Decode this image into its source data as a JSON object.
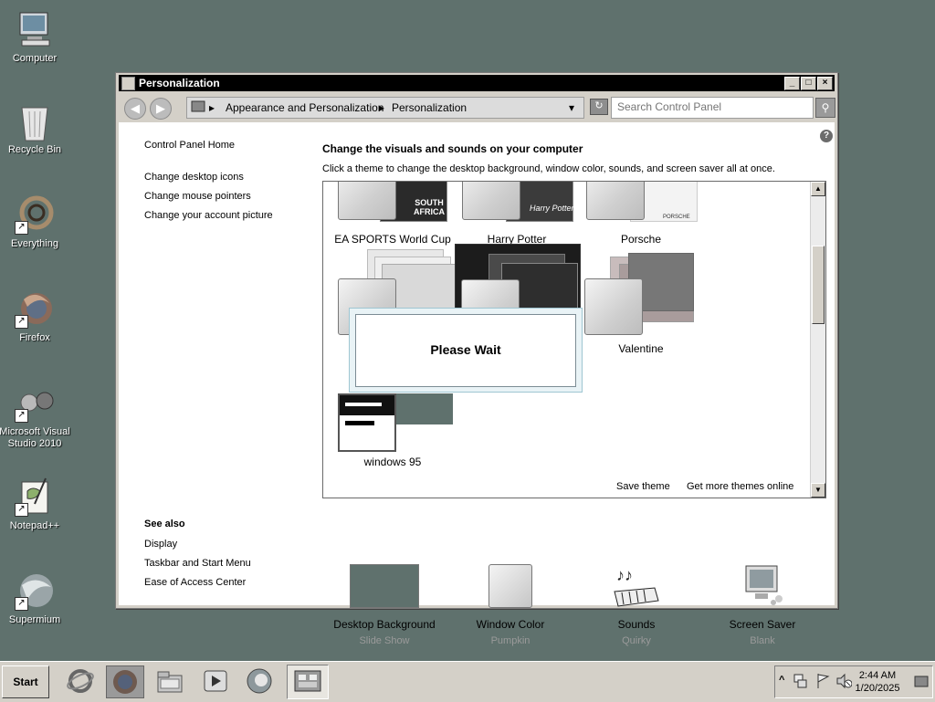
{
  "desktop": {
    "icons": [
      {
        "label": "Computer"
      },
      {
        "label": "Recycle Bin"
      },
      {
        "label": "Everything"
      },
      {
        "label": "Firefox"
      },
      {
        "label": "Microsoft Visual Studio 2010"
      },
      {
        "label": "Notepad++"
      },
      {
        "label": "Supermium"
      }
    ],
    "shortcut_glyph": "↗"
  },
  "window": {
    "title": "Personalization",
    "min_glyph": "_",
    "max_glyph": "□",
    "close_glyph": "×",
    "back_glyph": "◀",
    "fwd_glyph": "▶",
    "breadcrumb": [
      "Appearance and Personalization",
      "Personalization"
    ],
    "breadcrumb_sep": "▸",
    "dropdown_glyph": "▾",
    "refresh_glyph": "↻",
    "search_placeholder": "Search Control Panel",
    "search_glyph": "⚲",
    "help_glyph": "?"
  },
  "left_links": [
    "Control Panel Home",
    "Change desktop icons",
    "Change mouse pointers",
    "Change your account picture"
  ],
  "see_also": {
    "heading": "See also",
    "links": [
      "Display",
      "Taskbar and Start Menu",
      "Ease of Access Center"
    ]
  },
  "main": {
    "heading": "Change the visuals and sounds on your computer",
    "subheading": "Click a theme to change the desktop background, window color, sounds, and screen saver all at once."
  },
  "themes": [
    {
      "name": "EA SPORTS World Cup",
      "brand": "SOUTH AFRICA"
    },
    {
      "name": "Harry Potter",
      "brand": "Harry Potter"
    },
    {
      "name": "Porsche",
      "brand": "PORSCHE"
    },
    {
      "name": ""
    },
    {
      "name": ""
    },
    {
      "name": "Valentine"
    },
    {
      "name": "windows 95"
    }
  ],
  "theme_box_links": {
    "save": "Save theme",
    "more": "Get more themes online"
  },
  "scroll_up_glyph": "▲",
  "scroll_down_glyph": "▼",
  "dialog": {
    "text": "Please Wait"
  },
  "bottom_items": [
    {
      "name": "Desktop Background",
      "sub": "Slide Show"
    },
    {
      "name": "Window Color",
      "sub": "Pumpkin"
    },
    {
      "name": "Sounds",
      "sub": "Quirky"
    },
    {
      "name": "Screen Saver",
      "sub": "Blank"
    }
  ],
  "taskbar": {
    "start_label": "Start",
    "time": "2:44 AM",
    "date": "1/20/2025",
    "tray_arrow": "^"
  },
  "colors": {
    "desktop": "#5f716d",
    "title_bar": "#000000",
    "chrome": "#d4d0c8",
    "desktop_bg_swatch": "#5f716d"
  }
}
